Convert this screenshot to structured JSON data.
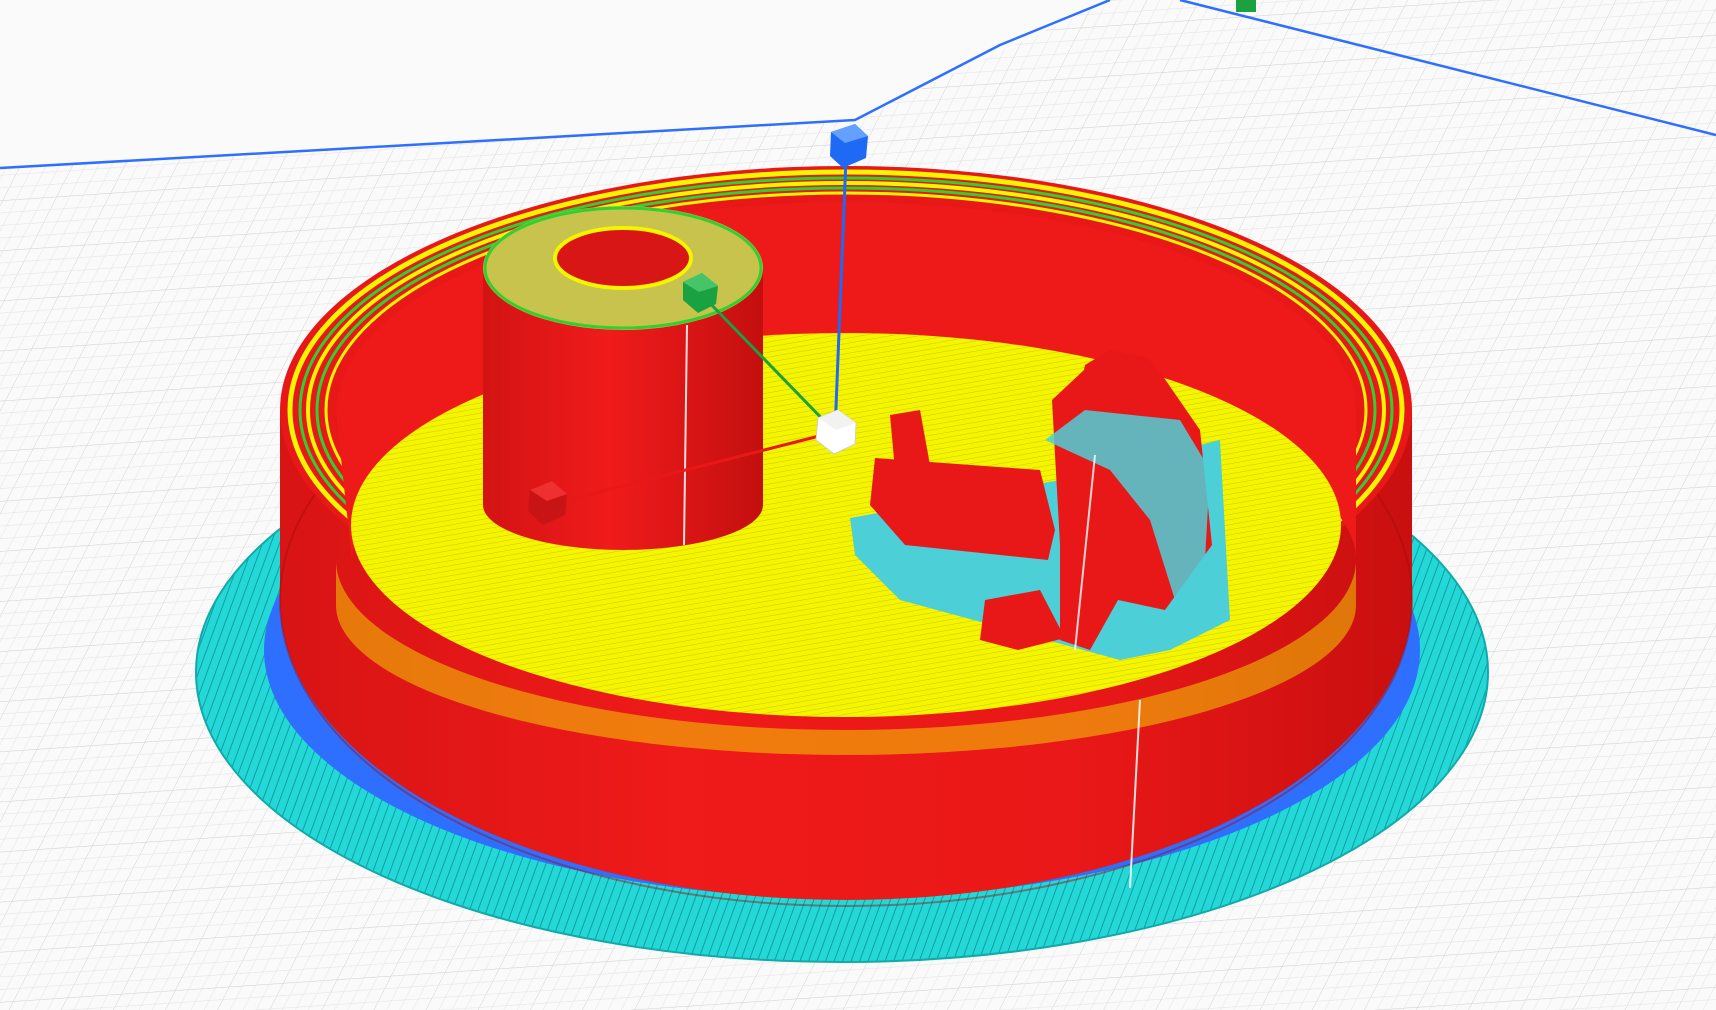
{
  "viewport": {
    "label": "",
    "colors": {
      "background": "#fafafa",
      "grid_line": "#cfcfcf",
      "build_plate_edge": "#2f6fff",
      "wall": "#e81818",
      "wall_shadow": "#b30f0f",
      "top_infill": "#f2f200",
      "inner_wall": "#2fd02f",
      "skirt_support": "#24d8d8",
      "gizmo_x": "#e81818",
      "gizmo_y": "#19a23f",
      "gizmo_z": "#1e6af5",
      "gizmo_center": "#ffffff"
    },
    "icons": [
      "axis-gizmo-icon",
      "z-axis-handle-icon",
      "y-axis-handle-icon",
      "x-axis-handle-icon",
      "origin-handle-icon"
    ]
  }
}
